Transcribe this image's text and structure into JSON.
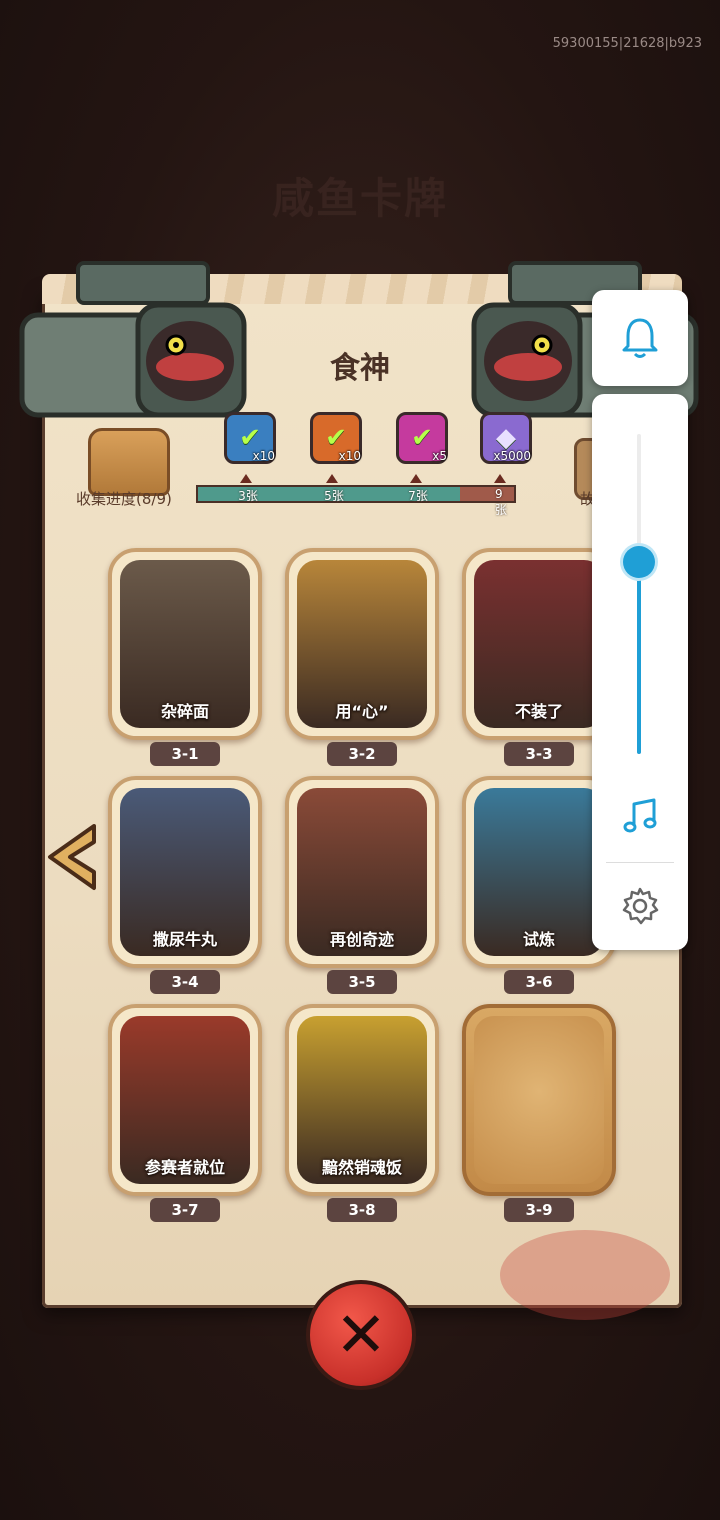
{
  "debug_id": "59300155|21628|b923",
  "background_title": "咸鱼卡牌",
  "card_set_title": "食神",
  "collection": {
    "label": "收集进度(8/9)",
    "collected": 8,
    "total": 9,
    "progress_fraction": 0.83,
    "milestones": [
      {
        "label": "3张",
        "count": 3,
        "reward_qty": "x10",
        "reward_icon": "chest-icon",
        "color": "#3a7fc0",
        "claimed": true
      },
      {
        "label": "5张",
        "count": 5,
        "reward_qty": "x10",
        "reward_icon": "ticket-icon",
        "color": "#d86a2a",
        "claimed": true
      },
      {
        "label": "7张",
        "count": 7,
        "reward_qty": "x5",
        "reward_icon": "orb-icon",
        "color": "#c53a9e",
        "claimed": true
      },
      {
        "label": "9张",
        "count": 9,
        "reward_qty": "x5000",
        "reward_icon": "crystal-icon",
        "color": "#8a6ad0",
        "claimed": false
      }
    ]
  },
  "side_label": "故",
  "cards": [
    {
      "name": "杂碎面",
      "number": "3-1",
      "unlocked": true,
      "art_color": "#6b5a4a"
    },
    {
      "name": "用“心”",
      "number": "3-2",
      "unlocked": true,
      "art_color": "#b8863a"
    },
    {
      "name": "不装了",
      "number": "3-3",
      "unlocked": true,
      "art_color": "#7a3030"
    },
    {
      "name": "撒尿牛丸",
      "number": "3-4",
      "unlocked": true,
      "art_color": "#4a5a78"
    },
    {
      "name": "再创奇迹",
      "number": "3-5",
      "unlocked": true,
      "art_color": "#8a4a38"
    },
    {
      "name": "试炼",
      "number": "3-6",
      "unlocked": true,
      "art_color": "#3a7a9a"
    },
    {
      "name": "参赛者就位",
      "number": "3-7",
      "unlocked": true,
      "art_color": "#9a3a2a"
    },
    {
      "name": "黯然销魂饭",
      "number": "3-8",
      "unlocked": true,
      "art_color": "#c8a030"
    },
    {
      "name": "",
      "number": "3-9",
      "unlocked": false,
      "art_color": "#c58d4a"
    }
  ],
  "close_icon": "close-x-icon",
  "overlay": {
    "volume_level": 0.6,
    "accent_color": "#1f9fd6",
    "icons": [
      "bell-icon",
      "music-note-icon",
      "gear-icon"
    ]
  }
}
